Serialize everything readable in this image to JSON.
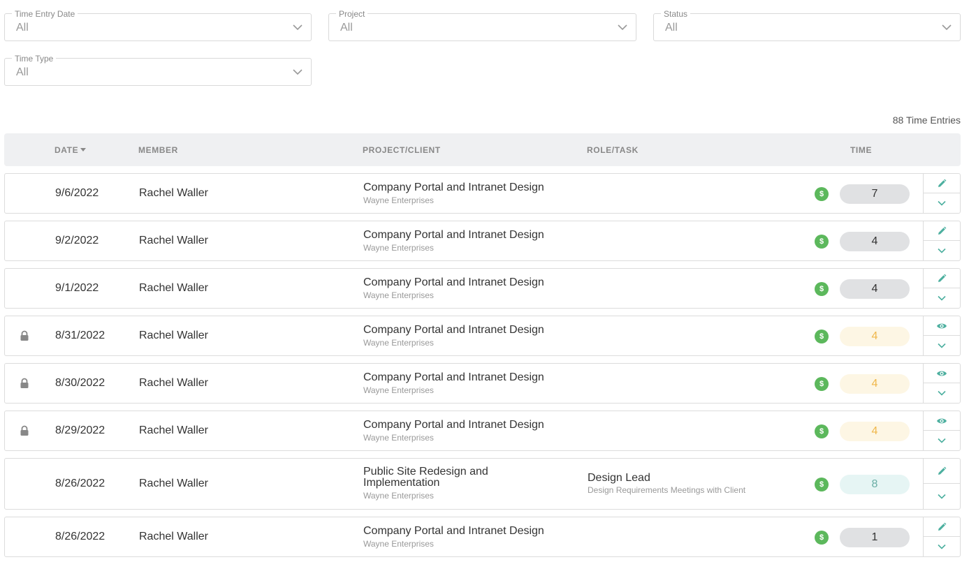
{
  "filters": [
    {
      "label": "Time Entry Date",
      "value": "All"
    },
    {
      "label": "Project",
      "value": "All"
    },
    {
      "label": "Status",
      "value": "All"
    },
    {
      "label": "Time Type",
      "value": "All"
    }
  ],
  "entries_count": "88 Time Entries",
  "columns": {
    "date": "DATE",
    "member": "MEMBER",
    "project": "PROJECT/CLIENT",
    "role": "ROLE/TASK",
    "time": "TIME"
  },
  "rows": [
    {
      "date": "9/6/2022",
      "member": "Rachel Waller",
      "project": "Company Portal and Intranet Design",
      "client": "Wayne Enterprises",
      "role": "",
      "task": "",
      "billable_icon": "$",
      "time": "7",
      "status": "grey",
      "locked": false,
      "action": "edit-icon"
    },
    {
      "date": "9/2/2022",
      "member": "Rachel Waller",
      "project": "Company Portal and Intranet Design",
      "client": "Wayne Enterprises",
      "role": "",
      "task": "",
      "billable_icon": "$",
      "time": "4",
      "status": "grey",
      "locked": false,
      "action": "edit-icon"
    },
    {
      "date": "9/1/2022",
      "member": "Rachel Waller",
      "project": "Company Portal and Intranet Design",
      "client": "Wayne Enterprises",
      "role": "",
      "task": "",
      "billable_icon": "$",
      "time": "4",
      "status": "grey",
      "locked": false,
      "action": "edit-icon"
    },
    {
      "date": "8/31/2022",
      "member": "Rachel Waller",
      "project": "Company Portal and Intranet Design",
      "client": "Wayne Enterprises",
      "role": "",
      "task": "",
      "billable_icon": "$",
      "time": "4",
      "status": "yellow",
      "locked": true,
      "action": "view-icon"
    },
    {
      "date": "8/30/2022",
      "member": "Rachel Waller",
      "project": "Company Portal and Intranet Design",
      "client": "Wayne Enterprises",
      "role": "",
      "task": "",
      "billable_icon": "$",
      "time": "4",
      "status": "yellow",
      "locked": true,
      "action": "view-icon"
    },
    {
      "date": "8/29/2022",
      "member": "Rachel Waller",
      "project": "Company Portal and Intranet Design",
      "client": "Wayne Enterprises",
      "role": "",
      "task": "",
      "billable_icon": "$",
      "time": "4",
      "status": "yellow",
      "locked": true,
      "action": "view-icon"
    },
    {
      "date": "8/26/2022",
      "member": "Rachel Waller",
      "project": "Public Site Redesign and Implementation",
      "client": "Wayne Enterprises",
      "role": "Design Lead",
      "task": "Design Requirements Meetings with Client",
      "billable_icon": "$",
      "time": "8",
      "status": "teal",
      "locked": false,
      "action": "edit-icon"
    },
    {
      "date": "8/26/2022",
      "member": "Rachel Waller",
      "project": "Company Portal and Intranet Design",
      "client": "Wayne Enterprises",
      "role": "",
      "task": "",
      "billable_icon": "$",
      "time": "1",
      "status": "grey",
      "locked": false,
      "action": "edit-icon"
    }
  ],
  "colors": {
    "accent": "#4caf9f",
    "billable": "#5cb85c",
    "pending": "#f0b74a"
  }
}
